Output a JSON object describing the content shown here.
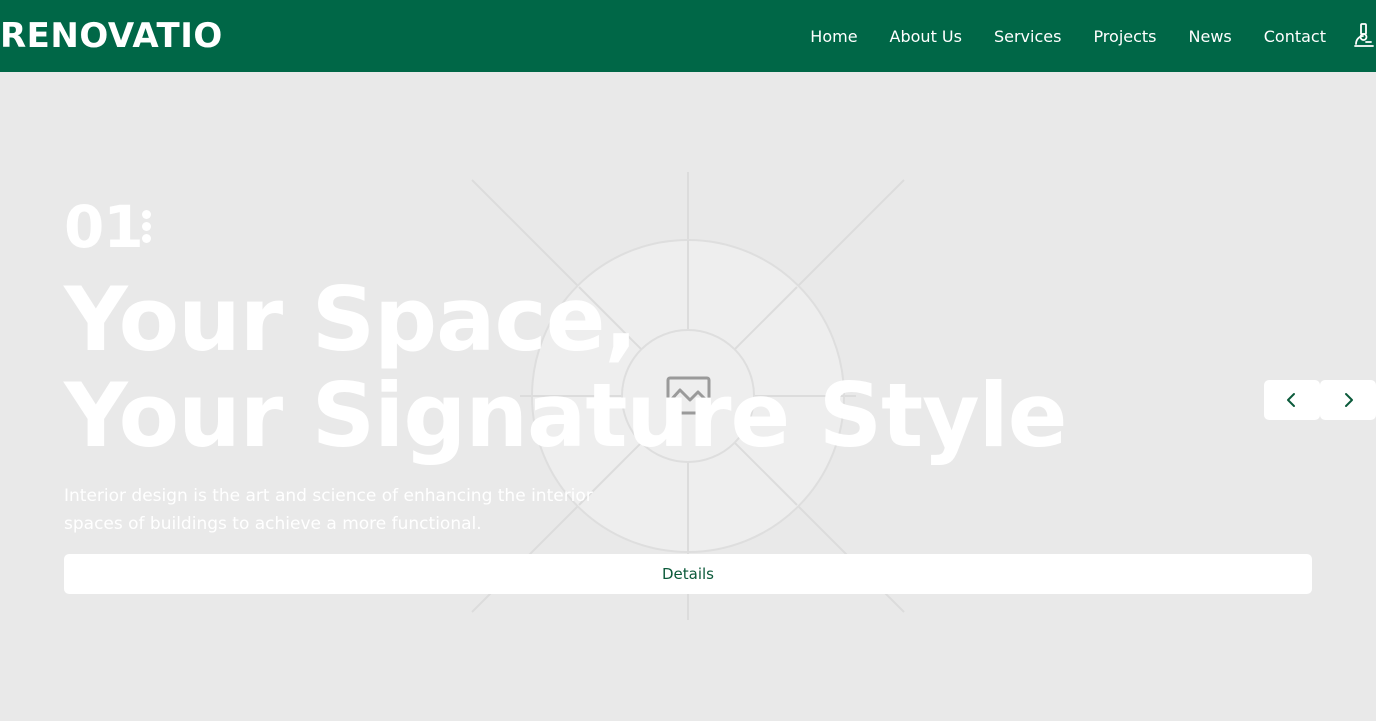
{
  "header": {
    "logo": "RENOVATIO",
    "nav": [
      "Home",
      "About Us",
      "Services",
      "Projects",
      "News",
      "Contact"
    ],
    "nav_icon": "microscope-icon"
  },
  "hero": {
    "slide_number": "01",
    "headline_line1": "Your Space,",
    "headline_line2": "Your Signature Style",
    "subtext": "Interior design is the art and science of enhancing the interior spaces of buildings to achieve a more functional.",
    "details_label": "Details",
    "prev_icon": "chevron-left-icon",
    "next_icon": "chevron-right-icon",
    "image_icon": "image-placeholder-icon"
  },
  "colors": {
    "brand_green": "#006747",
    "background": "#e9e9e9",
    "text_white": "#ffffff"
  }
}
